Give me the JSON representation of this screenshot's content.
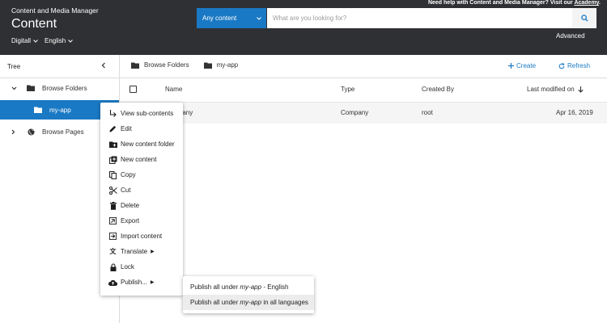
{
  "header": {
    "help_text": "Need help with Content and Media Manager? Visit our ",
    "help_link": "Academy",
    "help_end": ".",
    "app_name": "Content and Media Manager",
    "title": "Content",
    "site": "Digitall",
    "language": "English",
    "search": {
      "scope": "Any content",
      "placeholder": "What are you looking for?",
      "advanced": "Advanced"
    }
  },
  "sidebar": {
    "label": "Tree",
    "items": [
      {
        "label": "Browse Folders"
      },
      {
        "label": "my-app"
      },
      {
        "label": "Browse Pages"
      }
    ]
  },
  "breadcrumb": {
    "items": [
      "Browse Folders",
      "my-app"
    ]
  },
  "toolbar": {
    "create": "Create",
    "refresh": "Refresh"
  },
  "table": {
    "columns": [
      "Name",
      "Type",
      "Created By",
      "Last modified on"
    ],
    "rows": [
      {
        "name": "Company",
        "type": "Company",
        "created_by": "root",
        "modified": "Apr 16, 2019"
      }
    ]
  },
  "context_menu": {
    "items": [
      {
        "label": "View sub-contents",
        "icon": "subdirectory-arrow-icon"
      },
      {
        "label": "Edit",
        "icon": "pencil-icon"
      },
      {
        "label": "New content folder",
        "icon": "folder-plus-icon"
      },
      {
        "label": "New content",
        "icon": "library-add-icon"
      },
      {
        "label": "Copy",
        "icon": "copy-icon"
      },
      {
        "label": "Cut",
        "icon": "scissors-icon"
      },
      {
        "label": "Delete",
        "icon": "trash-icon"
      },
      {
        "label": "Export",
        "icon": "export-icon"
      },
      {
        "label": "Import content",
        "icon": "import-icon"
      },
      {
        "label": "Translate",
        "icon": "translate-icon"
      },
      {
        "label": "Lock",
        "icon": "lock-icon"
      },
      {
        "label": "Publish...",
        "icon": "cloud-upload-icon"
      }
    ]
  },
  "submenu": {
    "item1": {
      "prefix": "Publish all under ",
      "target": "my-app",
      "suffix": " - English"
    },
    "item2": {
      "prefix": "Publish all under ",
      "target": "my-app",
      "suffix": " in all languages"
    }
  },
  "colors": {
    "header_bg": "#2f3033",
    "accent": "#1a79c4",
    "row_hover": "#f5f5f5"
  }
}
